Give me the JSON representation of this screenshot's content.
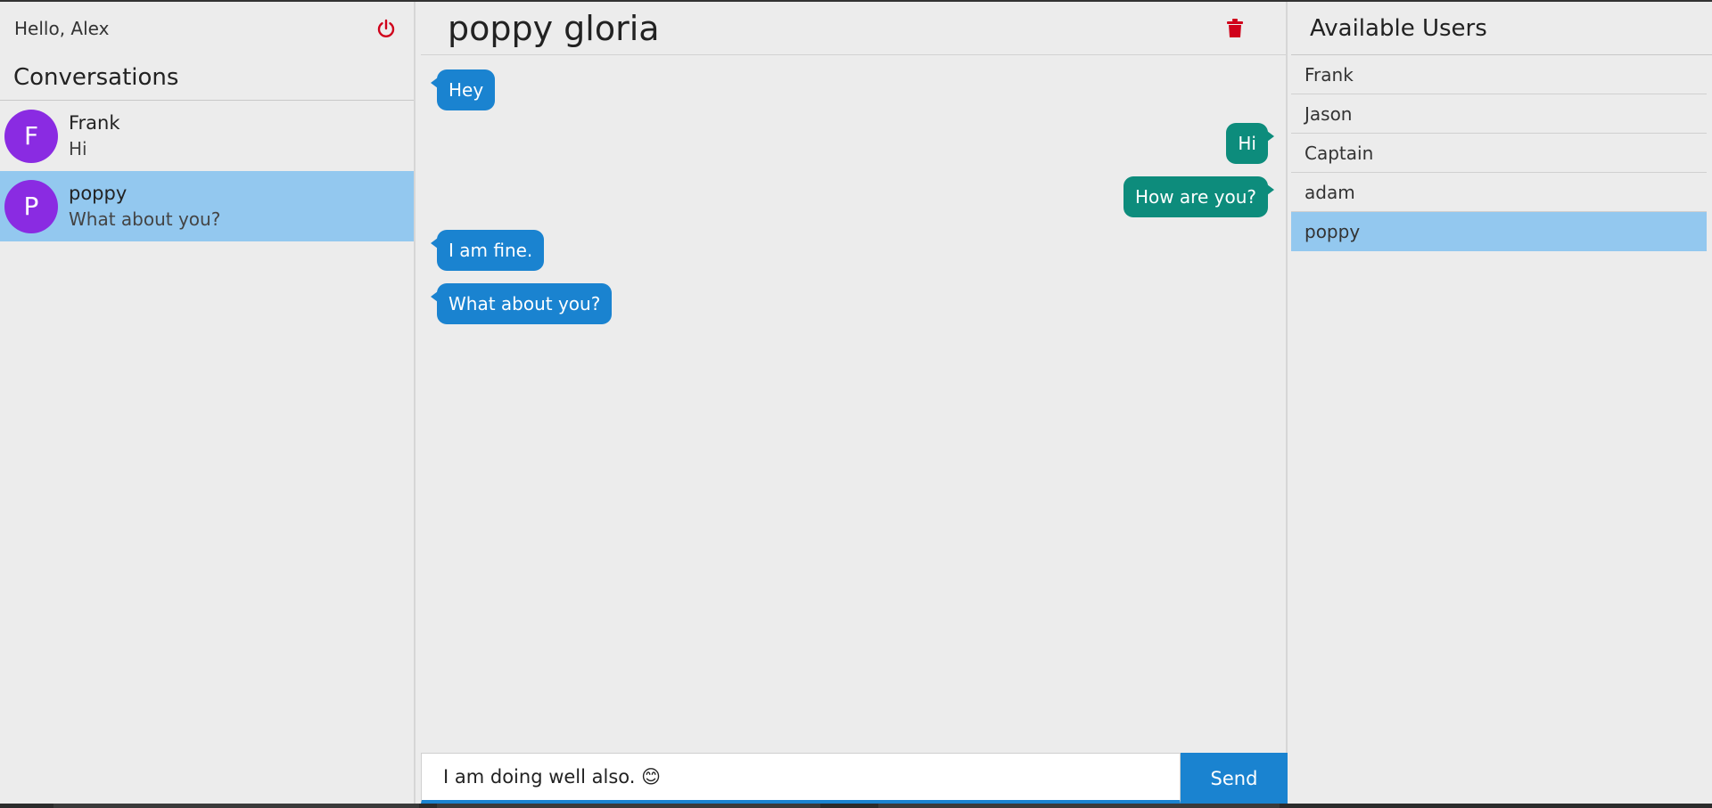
{
  "left": {
    "greeting": "Hello, Alex",
    "logout_icon": "power-icon",
    "conversations_title": "Conversations",
    "conversations": [
      {
        "initial": "F",
        "name": "Frank",
        "last_message": "Hi",
        "active": false
      },
      {
        "initial": "P",
        "name": "poppy",
        "last_message": "What about you?",
        "active": true
      }
    ]
  },
  "chat": {
    "title": "poppy gloria",
    "delete_icon": "trash-icon",
    "messages": [
      {
        "text": "Hey",
        "direction": "incoming"
      },
      {
        "text": "Hi",
        "direction": "outgoing"
      },
      {
        "text": "How are you?",
        "direction": "outgoing"
      },
      {
        "text": "I am fine.",
        "direction": "incoming"
      },
      {
        "text": "What about you?",
        "direction": "incoming"
      }
    ],
    "input_value": "I am doing well also. 😊",
    "send_label": "Send"
  },
  "users": {
    "title": "Available Users",
    "items": [
      "Frank",
      "Jason",
      "Captain",
      "adam",
      "poppy"
    ],
    "selected": "poppy"
  },
  "colors": {
    "incoming_bubble": "#1a83d0",
    "outgoing_bubble": "#0d8c7c",
    "selected_row": "#93c8ef",
    "avatar": "#8a2be2",
    "danger_icon": "#d0021b"
  }
}
